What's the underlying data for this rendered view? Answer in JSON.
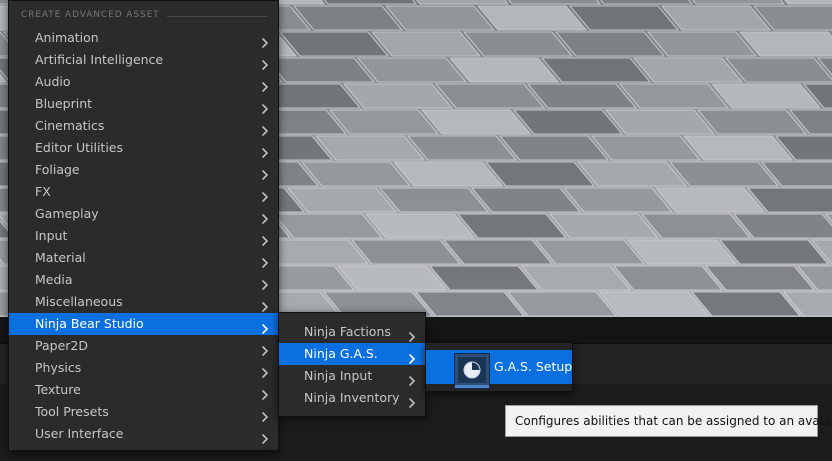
{
  "menu": {
    "header": "CREATE ADVANCED ASSET",
    "items": [
      {
        "label": "Animation"
      },
      {
        "label": "Artificial Intelligence"
      },
      {
        "label": "Audio"
      },
      {
        "label": "Blueprint"
      },
      {
        "label": "Cinematics"
      },
      {
        "label": "Editor Utilities"
      },
      {
        "label": "Foliage"
      },
      {
        "label": "FX"
      },
      {
        "label": "Gameplay"
      },
      {
        "label": "Input"
      },
      {
        "label": "Material"
      },
      {
        "label": "Media"
      },
      {
        "label": "Miscellaneous"
      },
      {
        "label": "Ninja Bear Studio",
        "active": true
      },
      {
        "label": "Paper2D"
      },
      {
        "label": "Physics"
      },
      {
        "label": "Texture"
      },
      {
        "label": "Tool Presets"
      },
      {
        "label": "User Interface"
      }
    ]
  },
  "submenu": {
    "items": [
      {
        "label": "Ninja Factions"
      },
      {
        "label": "Ninja G.A.S.",
        "active": true
      },
      {
        "label": "Ninja Input"
      },
      {
        "label": "Ninja Inventory"
      }
    ]
  },
  "asset_menu": {
    "asset_label": "G.A.S. Setup",
    "icon": "data-asset-icon"
  },
  "tooltip": {
    "text": "Configures abilities that can be assigned to an avatar."
  },
  "colors": {
    "highlight": "#0a70e0",
    "menu_bg": "#2b2b2b",
    "text": "#c6c6c6"
  }
}
